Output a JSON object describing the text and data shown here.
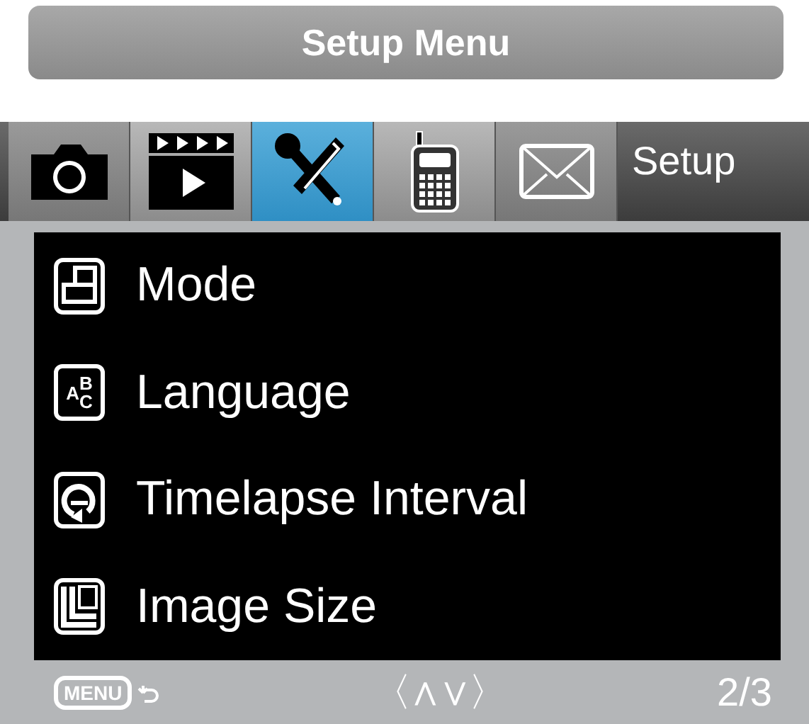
{
  "title": "Setup Menu",
  "tabs": [
    {
      "kind": "camera",
      "selected": false
    },
    {
      "kind": "video",
      "selected": false
    },
    {
      "kind": "tools",
      "selected": true
    },
    {
      "kind": "remote",
      "selected": false
    },
    {
      "kind": "envelope",
      "selected": false
    }
  ],
  "tab_label": "Setup",
  "items": [
    {
      "kind": "mode",
      "label": "Mode"
    },
    {
      "kind": "language",
      "label": "Language",
      "glyphs": [
        "A",
        "B",
        "C"
      ]
    },
    {
      "kind": "timelapse",
      "label": "Timelapse Interval"
    },
    {
      "kind": "size",
      "label": "Image Size"
    }
  ],
  "footer": {
    "menu_key": "MENU",
    "nav": "〈∧∨〉",
    "page": "2/3"
  }
}
